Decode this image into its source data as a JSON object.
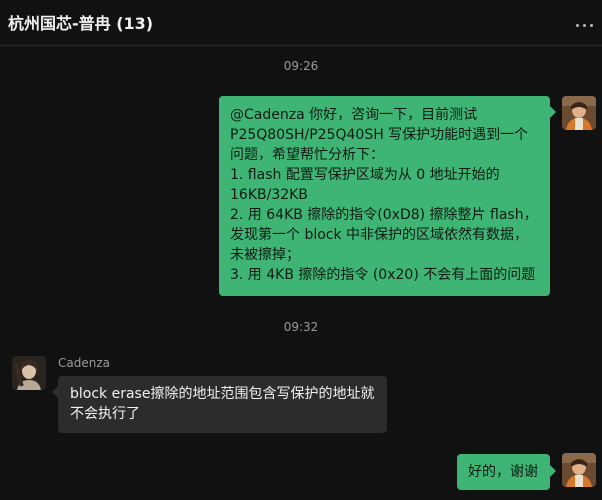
{
  "header": {
    "title": "杭州国芯-普冉 (13)",
    "more_icon": "more-dots-icon"
  },
  "messages": [
    {
      "timestamp": "09:26"
    },
    {
      "side": "right",
      "lines": [
        "@Cadenza 你好，咨询一下，目前测试",
        "P25Q80SH/P25Q40SH 写保护功能时遇到一个",
        "问题，希望帮忙分析下：",
        "1. flash 配置写保护区域为从 0 地址开始的",
        "16KB/32KB",
        "2. 用 64KB 擦除的指令(0xD8) 擦除整片 flash，",
        "发现第一个 block 中非保护的区域依然有数据，",
        "未被擦掉；",
        "3. 用 4KB 擦除的指令 (0x20) 不会有上面的问题"
      ]
    },
    {
      "timestamp": "09:32"
    },
    {
      "side": "left",
      "sender": "Cadenza",
      "lines": [
        "block erase擦除的地址范围包含写保护的地址就",
        "不会执行了"
      ]
    },
    {
      "side": "right",
      "lines": [
        "好的，谢谢"
      ]
    }
  ],
  "colors": {
    "background": "#111111",
    "own_bubble": "#3eb575",
    "other_bubble": "#2c2c2c",
    "timestamp": "#9a9a9a"
  }
}
